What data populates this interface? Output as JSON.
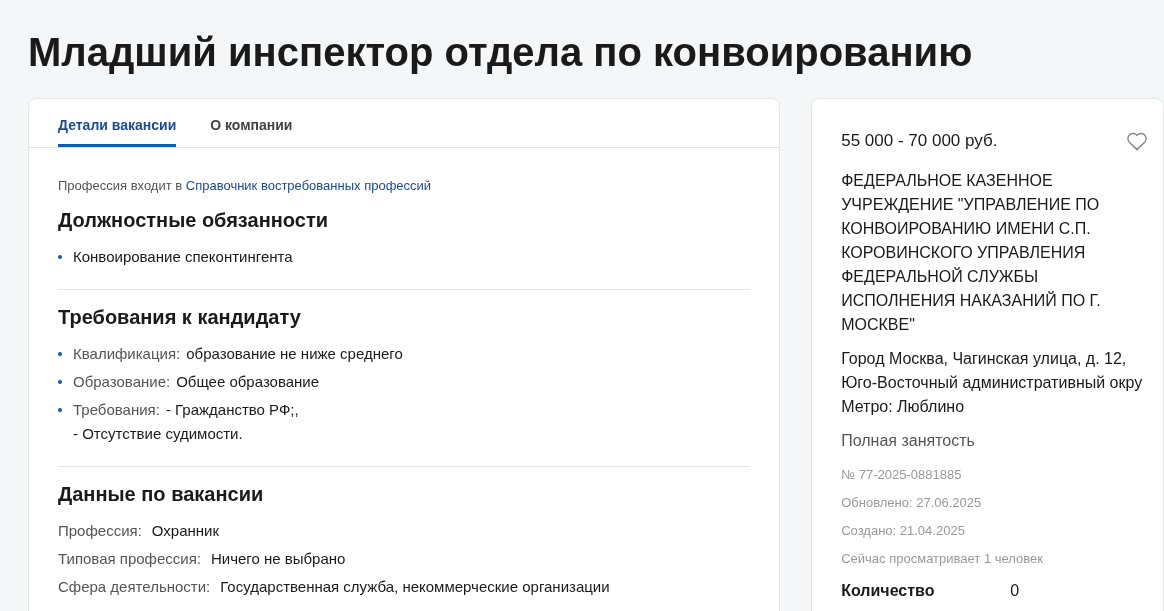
{
  "title": "Младший инспектор отдела по конвоированию",
  "tabs": [
    {
      "label": "Детали вакансии",
      "selected": true
    },
    {
      "label": "О компании",
      "selected": false
    }
  ],
  "profession_note": {
    "text": "Профессия входит в",
    "link": "Справочник востребованных профессий"
  },
  "sections": [
    {
      "kind": "bullets",
      "heading": "Должностные обязанности",
      "items": [
        {
          "value": "Конвоирование спеконтингента"
        }
      ]
    },
    {
      "kind": "bullets",
      "heading": "Требования к кандидату",
      "items": [
        {
          "label": "Квалификация:",
          "value": "образование не ниже среднего"
        },
        {
          "label": "Образование:",
          "value": "Общее образование"
        },
        {
          "label": "Требования:",
          "value": "- Гражданство РФ;,\n- Отсутствие судимости."
        }
      ]
    },
    {
      "kind": "rows",
      "heading": "Данные по вакансии",
      "items": [
        {
          "label": "Профессия:",
          "value": "Охранник"
        },
        {
          "label": "Типовая профессия:",
          "value": "Ничего не выбрано"
        },
        {
          "label": "Сфера деятельности:",
          "value": "Государственная служба, некоммерческие организации"
        }
      ]
    }
  ],
  "side_card": {
    "salary": "55 000 - 70 000 руб.",
    "employer": "ФЕДЕРАЛЬНОЕ КАЗЕННОЕ УЧРЕЖДЕНИЕ \"УПРАВЛЕНИЕ ПО КОНВОИРОВАНИЮ ИМЕНИ С.П. КОРОВИНСКОГО УПРАВЛЕНИЯ ФЕДЕРАЛЬНОЙ СЛУЖБЫ ИСПОЛНЕНИЯ НАКАЗАНИЙ ПО Г. МОСКВЕ\"",
    "address_lines": [
      "Город Москва, Чагинская улица, д. 12,",
      "Юго-Восточный административный окру",
      "Метро: Люблино"
    ],
    "employment": "Полная занятость",
    "meta": [
      "№ 77-2025-0881885",
      "Обновлено: 27.06.2025",
      "Создано: 21.04.2025",
      "Сейчас просматривает 1 человек"
    ],
    "applications": {
      "label": "Количество",
      "value": "0"
    }
  }
}
